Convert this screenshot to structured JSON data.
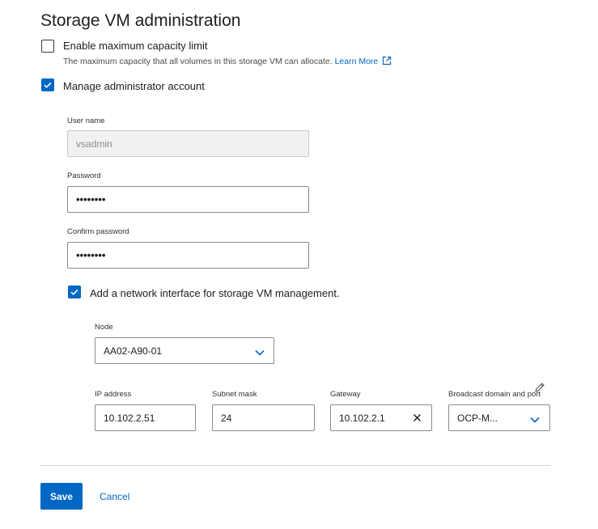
{
  "section": {
    "title": "Storage VM administration"
  },
  "max_capacity": {
    "label": "Enable maximum capacity limit",
    "checked": false,
    "helper": "The maximum capacity that all volumes in this storage VM can allocate.",
    "learn_more": "Learn More"
  },
  "admin_account": {
    "label": "Manage administrator account",
    "checked": true,
    "username": {
      "label": "User name",
      "value": "vsadmin"
    },
    "password": {
      "label": "Password",
      "value": "••••••••"
    },
    "confirm_password": {
      "label": "Confirm password",
      "value": "••••••••"
    }
  },
  "network_interface": {
    "label": "Add a network interface for storage VM management.",
    "checked": true,
    "node": {
      "label": "Node",
      "value": "AA02-A90-01"
    },
    "ip_address": {
      "label": "IP address",
      "value": "10.102.2.51"
    },
    "subnet_mask": {
      "label": "Subnet mask",
      "value": "24"
    },
    "gateway": {
      "label": "Gateway",
      "value": "10.102.2.1"
    },
    "broadcast_domain": {
      "label": "Broadcast domain and port",
      "value": "OCP-M..."
    }
  },
  "actions": {
    "save": "Save",
    "cancel": "Cancel"
  },
  "colors": {
    "accent": "#0067c5"
  }
}
